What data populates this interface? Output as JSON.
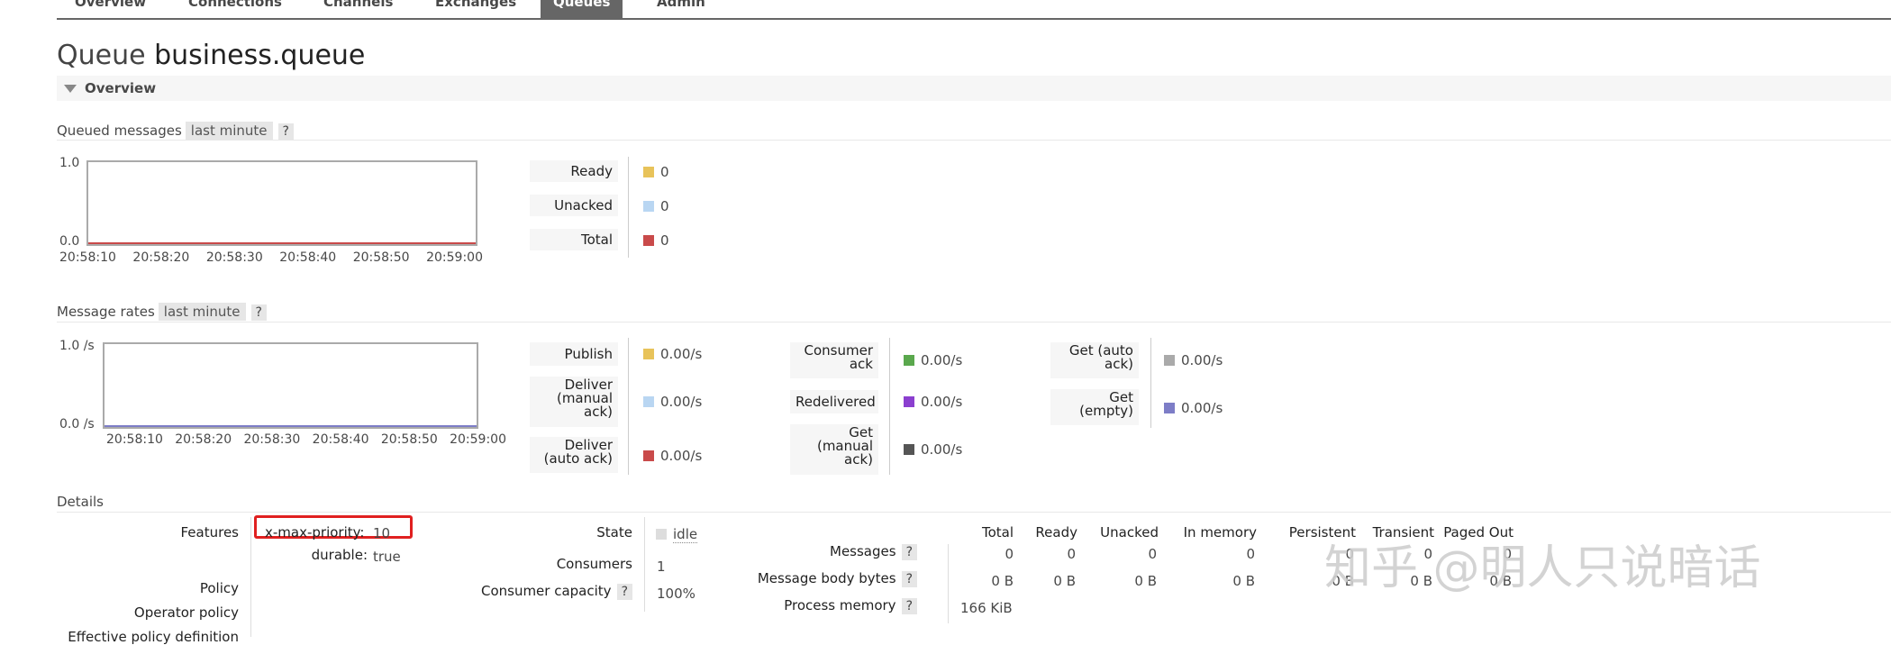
{
  "nav": {
    "tabs": [
      "Overview",
      "Connections",
      "Channels",
      "Exchanges",
      "Queues",
      "Admin"
    ],
    "active": "Queues"
  },
  "page": {
    "title_prefix": "Queue",
    "title_name": "business.queue"
  },
  "overview": {
    "label": "Overview"
  },
  "queued_messages": {
    "title": "Queued messages",
    "range": "last minute",
    "help": "?",
    "y_max": "1.0",
    "y_min": "0.0",
    "x_ticks": [
      "20:58:10",
      "20:58:20",
      "20:58:30",
      "20:58:40",
      "20:58:50",
      "20:59:00"
    ],
    "legend": [
      {
        "label": "Ready",
        "value": "0",
        "color": "#e8c35a"
      },
      {
        "label": "Unacked",
        "value": "0",
        "color": "#b9d6f2"
      },
      {
        "label": "Total",
        "value": "0",
        "color": "#c94a4a"
      }
    ]
  },
  "message_rates": {
    "title": "Message rates",
    "range": "last minute",
    "help": "?",
    "y_max": "1.0 /s",
    "y_min": "0.0 /s",
    "x_ticks": [
      "20:58:10",
      "20:58:20",
      "20:58:30",
      "20:58:40",
      "20:58:50",
      "20:59:00"
    ],
    "col1": [
      {
        "label": "Publish",
        "value": "0.00/s",
        "color": "#e8c35a"
      },
      {
        "label": "Deliver (manual ack)",
        "value": "0.00/s",
        "color": "#b9d6f2"
      },
      {
        "label": "Deliver (auto ack)",
        "value": "0.00/s",
        "color": "#c94a4a"
      }
    ],
    "col2": [
      {
        "label": "Consumer ack",
        "value": "0.00/s",
        "color": "#5aa84d"
      },
      {
        "label": "Redelivered",
        "value": "0.00/s",
        "color": "#8b3fcf"
      },
      {
        "label": "Get (manual ack)",
        "value": "0.00/s",
        "color": "#555555"
      }
    ],
    "col3": [
      {
        "label": "Get (auto ack)",
        "value": "0.00/s",
        "color": "#aaaaaa"
      },
      {
        "label": "Get (empty)",
        "value": "0.00/s",
        "color": "#7d7dc7"
      }
    ]
  },
  "details": {
    "title": "Details",
    "features_label": "Features",
    "feature_1_key": "x-max-priority:",
    "feature_1_val": "10",
    "feature_2_key": "durable:",
    "feature_2_val": "true",
    "policy_label": "Policy",
    "operator_policy_label": "Operator policy",
    "effective_policy_label": "Effective policy definition",
    "state_label": "State",
    "state_value": "idle",
    "consumers_label": "Consumers",
    "consumers_value": "1",
    "capacity_label": "Consumer capacity",
    "capacity_help": "?",
    "capacity_value": "100%",
    "table": {
      "headers": [
        "Total",
        "Ready",
        "Unacked",
        "In memory",
        "Persistent",
        "Transient",
        "Paged Out"
      ],
      "messages_label": "Messages",
      "messages_values": [
        "0",
        "0",
        "0",
        "0",
        "0",
        "0",
        "0"
      ],
      "bytes_label": "Message body bytes",
      "bytes_values": [
        "0 B",
        "0 B",
        "0 B",
        "0 B",
        "0 B",
        "0 B",
        "0 B"
      ],
      "process_label": "Process memory",
      "process_value": "166 KiB",
      "help": "?"
    }
  },
  "watermark": {
    "text": "知乎 @明人只说暗话"
  }
}
